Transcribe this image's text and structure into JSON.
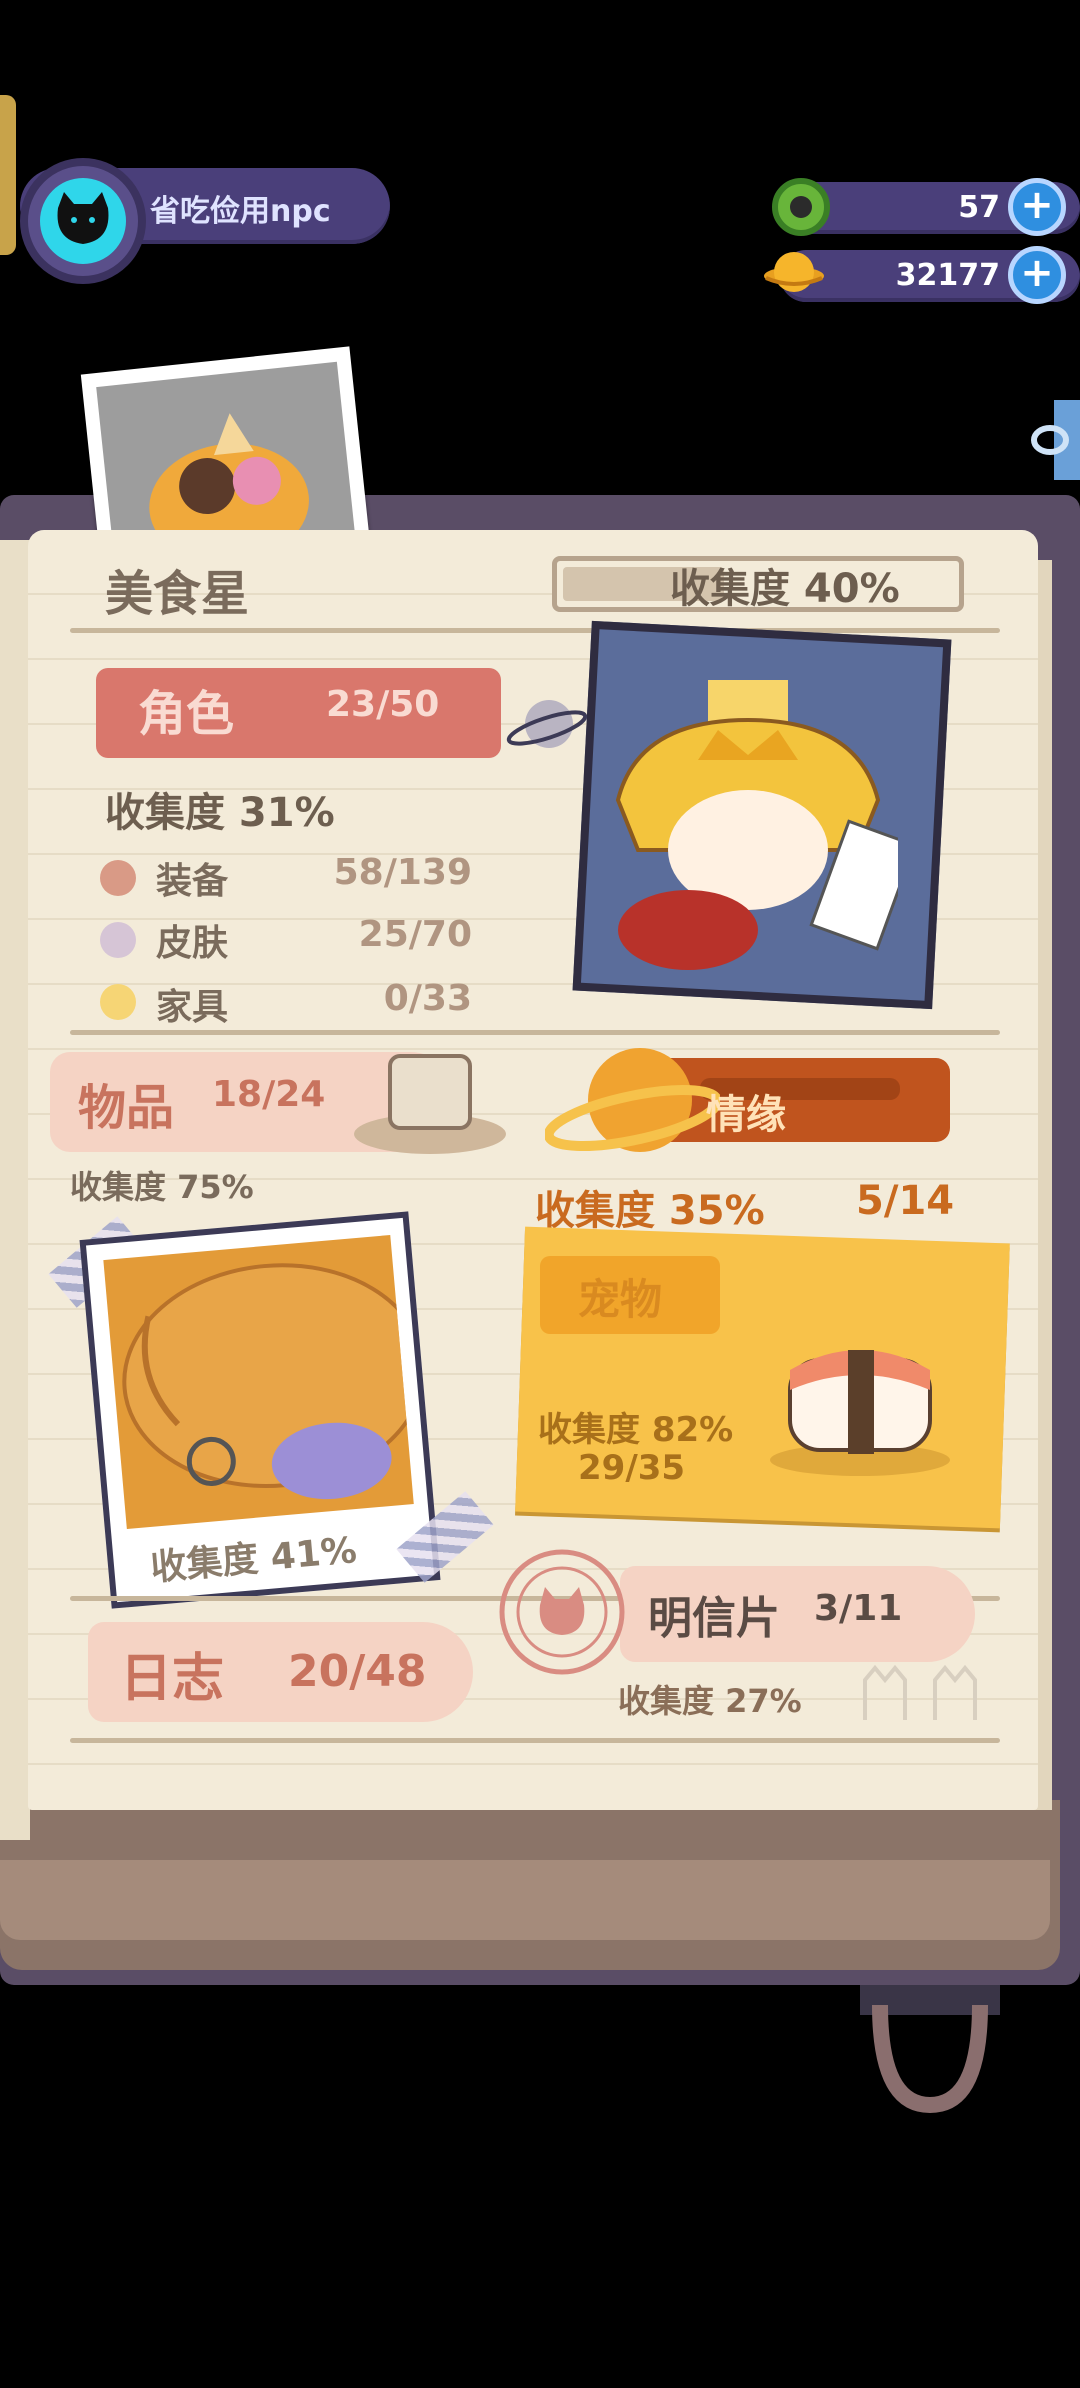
{
  "player": {
    "name": "省吃俭用npc"
  },
  "resources": [
    {
      "icon": "donut-icon",
      "value": "57"
    },
    {
      "icon": "planet-coin-icon",
      "value": "32177"
    }
  ],
  "book": {
    "title": "美食星",
    "overall_collection": {
      "label": "收集度 40%",
      "fraction": 0.4
    },
    "character": {
      "label": "角色",
      "count": "23/50",
      "collection": "收集度 31%",
      "subitems": [
        {
          "label": "装备",
          "count": "58/139",
          "color": "#d99a86"
        },
        {
          "label": "皮肤",
          "count": "25/70",
          "color": "#d6c5d6"
        },
        {
          "label": "家具",
          "count": "0/33",
          "color": "#f6d575"
        }
      ]
    },
    "items": {
      "label": "物品",
      "count": "18/24",
      "collection": "收集度 75%"
    },
    "bond": {
      "label": "情缘",
      "collection": "收集度 35%",
      "count": "5/14"
    },
    "food_photo": {
      "collection": "收集度 41%"
    },
    "pets": {
      "label": "宠物",
      "collection": "收集度 82%",
      "count": "29/35"
    },
    "diary": {
      "label": "日志",
      "count": "20/48"
    },
    "postcards": {
      "label": "明信片",
      "count": "3/11",
      "collection": "收集度 27%"
    }
  },
  "colors": {
    "accent_blue": "#2f8fe0",
    "banner_red": "#d9776c",
    "pet_yellow": "#f8c24a",
    "bond_orange": "#c0541e"
  }
}
